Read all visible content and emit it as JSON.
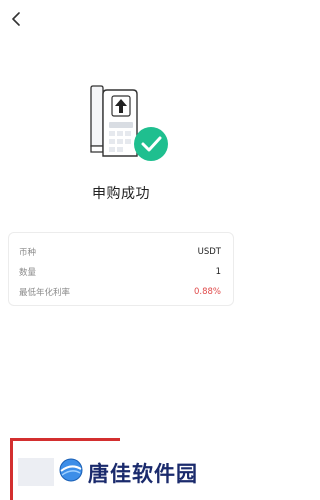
{
  "header": {
    "back_icon": "chevron-left-icon"
  },
  "result": {
    "title": "申购成功",
    "illustration": "receipt-success-illustration",
    "check_color": "#1fbf8f"
  },
  "details": [
    {
      "label": "币种",
      "value": "USDT"
    },
    {
      "label": "数量",
      "value": "1"
    },
    {
      "label": "最低年化利率",
      "value": "0.88%",
      "value_color": "#e04a4a"
    }
  ],
  "watermark": {
    "text": "唐佳软件园"
  }
}
